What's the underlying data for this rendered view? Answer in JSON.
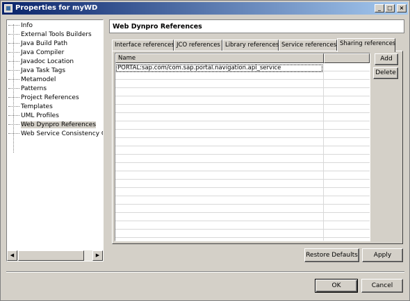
{
  "window": {
    "title": "Properties for myWD",
    "controls": [
      "minimize-icon",
      "maximize-icon",
      "close-icon"
    ]
  },
  "tree": {
    "items": [
      {
        "label": "Info"
      },
      {
        "label": "External Tools Builders"
      },
      {
        "label": "Java Build Path"
      },
      {
        "label": "Java Compiler"
      },
      {
        "label": "Javadoc Location"
      },
      {
        "label": "Java Task Tags"
      },
      {
        "label": "Metamodel"
      },
      {
        "label": "Patterns"
      },
      {
        "label": "Project References"
      },
      {
        "label": "Templates"
      },
      {
        "label": "UML Profiles"
      },
      {
        "label": "Web Dynpro References",
        "selected": true
      },
      {
        "label": "Web Service Consistency Chec"
      }
    ]
  },
  "page": {
    "title": "Web Dynpro References",
    "tabs": [
      {
        "label": "Interface references"
      },
      {
        "label": "JCO references"
      },
      {
        "label": "Library references"
      },
      {
        "label": "Service references"
      },
      {
        "label": "Sharing references",
        "active": true
      }
    ],
    "table": {
      "columns": [
        "Name",
        ""
      ],
      "rows": [
        [
          "PORTAL:sap.com/com.sap.portal.navigation.api_service",
          ""
        ]
      ]
    },
    "buttons": {
      "add": "Add",
      "delete": "Delete"
    }
  },
  "footer": {
    "restore_defaults": "Restore Defaults",
    "apply": "Apply",
    "ok": "OK",
    "cancel": "Cancel"
  },
  "colors": {
    "title_bar_start": "#0a246a",
    "title_bar_end": "#a6caf0",
    "face": "#d4d0c8"
  }
}
